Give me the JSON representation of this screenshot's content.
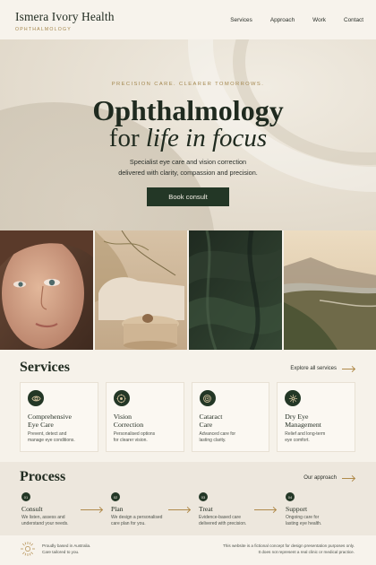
{
  "brand": {
    "name": "Ismera Ivory Health",
    "tagline": "OPHTHALMOLOGY"
  },
  "nav": {
    "items": [
      "Services",
      "Approach",
      "Work",
      "Contact"
    ]
  },
  "hero": {
    "eyebrow": "PRECISION CARE. CLEARER TOMORROWS.",
    "title_line1": "Ophthalmology",
    "title_line2_prefix": "for ",
    "title_line2_italic": "life in focus",
    "subtitle_line1": "Specialist eye care and vision correction",
    "subtitle_line2": "delivered with clarity, compassion and precision.",
    "cta": "Book consult"
  },
  "services": {
    "title": "Services",
    "explore_label": "Explore all services",
    "cards": [
      {
        "icon": "eye-icon",
        "title_line1": "Comprehensive",
        "title_line2": "Eye Care",
        "desc_line1": "Prevent, detect and",
        "desc_line2": "manage eye conditions."
      },
      {
        "icon": "vision-target-icon",
        "title_line1": "Vision",
        "title_line2": "Correction",
        "desc_line1": "Personalised options",
        "desc_line2": "for clearer vision."
      },
      {
        "icon": "cataract-lens-icon",
        "title_line1": "Cataract",
        "title_line2": "Care",
        "desc_line1": "Advanced care for",
        "desc_line2": "lasting clarity."
      },
      {
        "icon": "sparkle-icon",
        "title_line1": "Dry Eye",
        "title_line2": "Management",
        "desc_line1": "Relief and long-term",
        "desc_line2": "eye comfort."
      }
    ]
  },
  "process": {
    "title": "Process",
    "approach_label": "Our approach",
    "steps": [
      {
        "num": "01",
        "title": "Consult",
        "desc_line1": "We listen, assess and",
        "desc_line2": "understand your needs."
      },
      {
        "num": "02",
        "title": "Plan",
        "desc_line1": "We design a personalised",
        "desc_line2": "care plan for you."
      },
      {
        "num": "03",
        "title": "Treat",
        "desc_line1": "Evidence-based care",
        "desc_line2": "delivered with precision."
      },
      {
        "num": "04",
        "title": "Support",
        "desc_line1": "Ongoing care for",
        "desc_line2": "lasting eye health."
      }
    ]
  },
  "footer": {
    "left_line1": "Proudly based in Australia.",
    "left_line2": "Care tailored to you.",
    "right_line1": "This website is a fictional concept for design presentation purposes only.",
    "right_line2": "It does not represent a real clinic or medical practice."
  },
  "colors": {
    "accent": "#233726",
    "gold": "#a4864b",
    "background": "#f6f2ea"
  }
}
